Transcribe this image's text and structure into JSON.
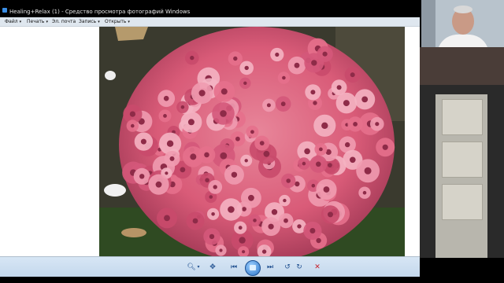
{
  "window": {
    "title": "Healing+Relax (1) - Средство просмотра фотографий Windows"
  },
  "menu": {
    "items": [
      {
        "label": "Файл",
        "has_caret": true
      },
      {
        "label": "Печать",
        "has_caret": true
      },
      {
        "label": "Эл. почта",
        "has_caret": false
      },
      {
        "label": "Запись",
        "has_caret": true
      },
      {
        "label": "Открыть",
        "has_caret": true
      }
    ],
    "caret": "▾"
  },
  "photo": {
    "subject": "pink chrysanthemum bush"
  },
  "toolbar": {
    "zoom_glyph": "🔍︎",
    "zoom_caret": "▾",
    "fit_glyph": "✥",
    "prev_glyph": "⏮",
    "next_glyph": "⏭",
    "rotate_ccw_glyph": "↺",
    "rotate_cw_glyph": "↻",
    "delete_glyph": "✕"
  },
  "colors": {
    "titlebar_bg": "#000000",
    "menubar_bg": "#dfe7ef",
    "toolbar_bg": "#c3d7ec",
    "delete_red": "#c8202a",
    "flower_pink": "#e0607a"
  }
}
